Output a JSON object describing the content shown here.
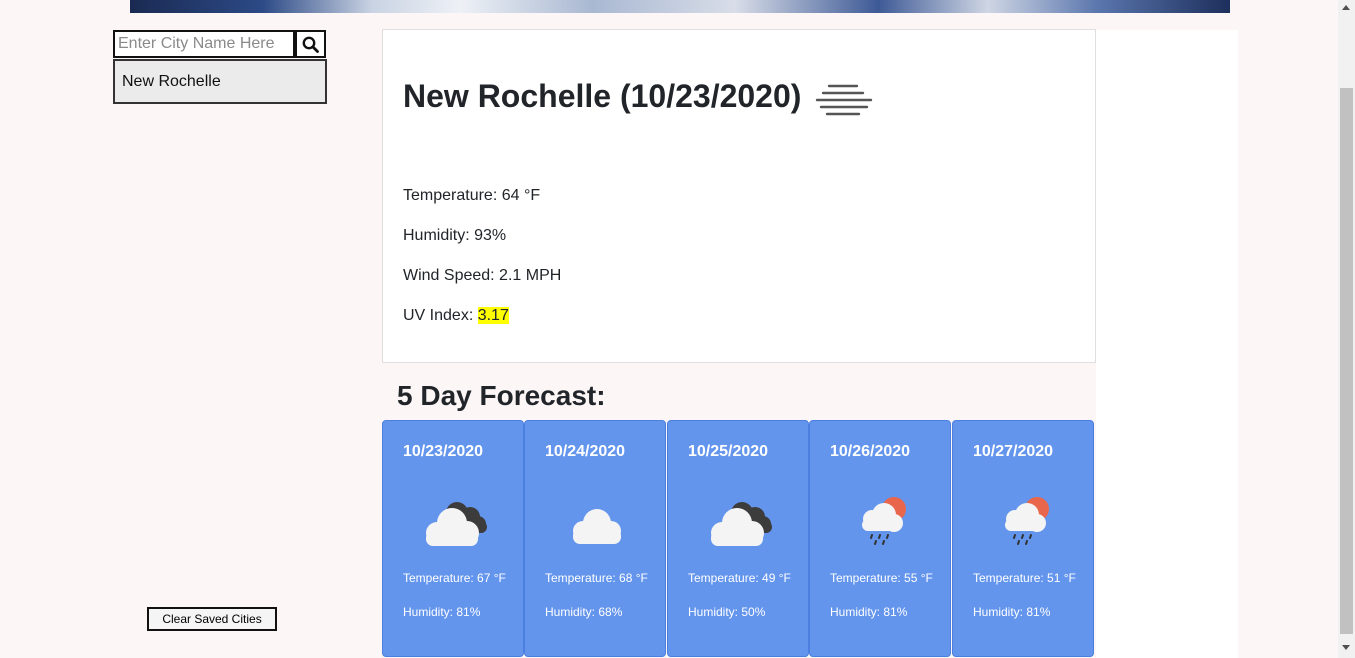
{
  "search": {
    "placeholder": "Enter City Name Here",
    "value": ""
  },
  "saved_cities": [
    "New Rochelle"
  ],
  "sidebar": {
    "clear_label": "Clear Saved Cities"
  },
  "current": {
    "title": "New Rochelle (10/23/2020)",
    "icon": "mist-icon",
    "temperature": "Temperature: 64 °F",
    "humidity": "Humidity: 93%",
    "wind": "Wind Speed: 2.1 MPH",
    "uv_label": "UV Index: ",
    "uv_value": "3.17",
    "uv_color": "#ffff00"
  },
  "forecast": {
    "title": "5 Day Forecast:",
    "days": [
      {
        "date": "10/23/2020",
        "icon": "broken-clouds-icon",
        "temp": "Temperature: 67 °F",
        "humidity": "Humidity: 81%"
      },
      {
        "date": "10/24/2020",
        "icon": "cloud-icon",
        "temp": "Temperature: 68 °F",
        "humidity": "Humidity: 68%"
      },
      {
        "date": "10/25/2020",
        "icon": "broken-clouds-icon",
        "temp": "Temperature: 49 °F",
        "humidity": "Humidity: 50%"
      },
      {
        "date": "10/26/2020",
        "icon": "rain-sun-icon",
        "temp": "Temperature: 55 °F",
        "humidity": "Humidity: 81%"
      },
      {
        "date": "10/27/2020",
        "icon": "rain-sun-icon",
        "temp": "Temperature: 51 °F",
        "humidity": "Humidity: 81%"
      }
    ],
    "card_color": "#6495ed"
  }
}
